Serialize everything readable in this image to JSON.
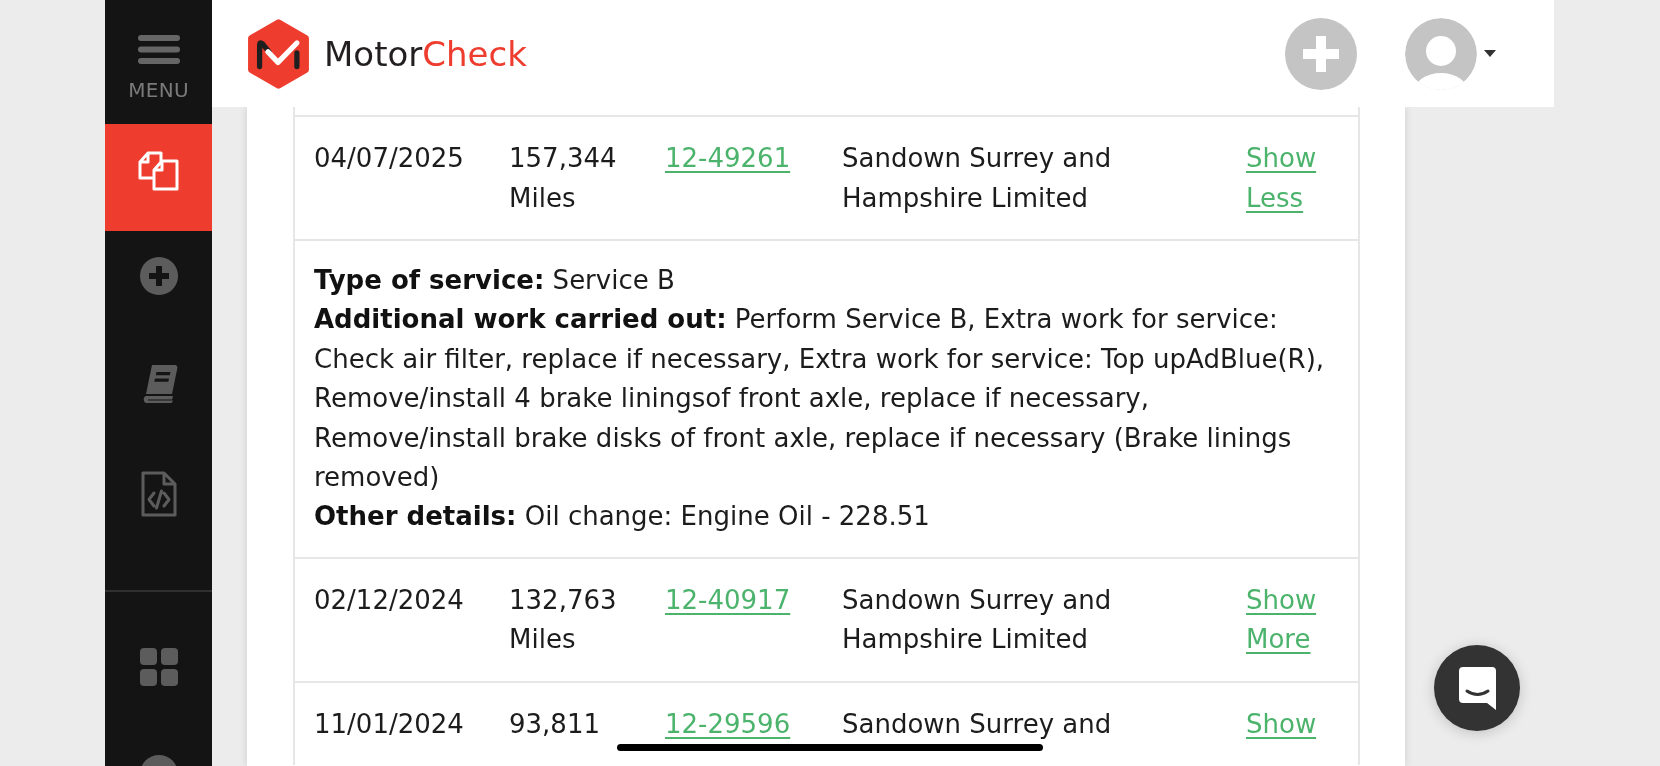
{
  "sidebar": {
    "menu_label": "MENU",
    "items": [
      {
        "selected": true
      },
      {
        "selected": false
      },
      {
        "selected": false
      },
      {
        "selected": false
      }
    ],
    "bottom_items": [
      {
        "selected": false
      },
      {
        "selected": false
      }
    ]
  },
  "header": {
    "brand": {
      "text": "Motor",
      "accent_text": "Check"
    }
  },
  "service_history": {
    "rows": [
      {
        "kind": "record",
        "date": "04/07/2025",
        "mileage": "157,344 Miles",
        "job_number": "12-49261",
        "dealer": "Sandown Surrey and Hampshire Limited",
        "toggle": "Show Less"
      },
      {
        "kind": "details",
        "lines": [
          "**Type of service:** Service B",
          "**Additional work carried out:** Perform Service B, Extra work for service: Check air filter, replace if necessary, Extra work for service: Top upAdBlue(R), Remove/install 4 brake liningsof front axle, replace if necessary, Remove/install brake disks of front axle, replace if necessary (Brake linings removed)",
          "**Other details:** Oil change: Engine Oil - 228.51"
        ]
      },
      {
        "kind": "record",
        "date": "02/12/2024",
        "mileage": "132,763 Miles",
        "job_number": "12-40917",
        "dealer": "Sandown Surrey and Hampshire Limited",
        "toggle": "Show More"
      },
      {
        "kind": "record",
        "date": "11/01/2024",
        "mileage": "93,811",
        "job_number": "12-29596",
        "dealer": "Sandown Surrey and",
        "toggle": "Show"
      }
    ]
  }
}
